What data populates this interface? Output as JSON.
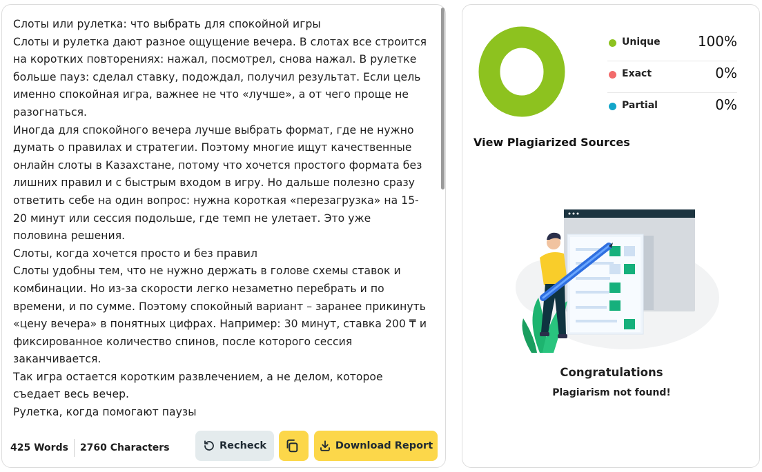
{
  "article": {
    "paragraphs": [
      "Слоты или рулетка: что выбрать для спокойной игры",
      "Слоты и рулетка дают разное ощущение вечера. В слотах все строится на коротких повторениях: нажал, посмотрел, снова нажал. В рулетке больше пауз: сделал ставку, подождал, получил результат. Если цель именно спокойная игра, важнее не что «лучше», а от чего проще не разогнаться.",
      "Иногда для спокойного вечера лучше выбрать формат, где не нужно думать о правилах и стратегии. Поэтому многие ищут качественные онлайн слоты в Казахстане, потому что хочется простого формата без лишних правил и с быстрым входом в игру. Но дальше полезно сразу ответить себе на один вопрос: нужна короткая «перезагрузка» на 15-20 минут или сессия подольше, где темп не улетает. Это уже половина решения.",
      "Слоты, когда хочется просто и без правил",
      "Слоты удобны тем, что не нужно держать в голове схемы ставок и комбинации. Но из-за скорости легко незаметно перебрать и по времени, и по сумме. Поэтому спокойный вариант – заранее прикинуть «цену вечера» в понятных цифрах. Например: 30 минут, ставка 200 ₸ и фиксированное количество спинов, после которого сессия заканчивается.",
      "Так игра остается коротким развлечением, а не делом, которое съедает весь вечер.",
      "Рулетка, когда помогают паузы"
    ]
  },
  "footer": {
    "words": "425 Words",
    "characters": "2760 Characters",
    "recheck_label": "Recheck",
    "download_label": "Download Report"
  },
  "results": {
    "legend": [
      {
        "label": "Unique",
        "value": "100%",
        "percent": 100,
        "color": "#8dc21f"
      },
      {
        "label": "Exact",
        "value": "0%",
        "percent": 0,
        "color": "#f26b6b"
      },
      {
        "label": "Partial",
        "value": "0%",
        "percent": 0,
        "color": "#13a5c9"
      }
    ],
    "view_sources": "View Plagiarized Sources",
    "congrats": "Congratulations",
    "not_found": "Plagiarism not found!"
  },
  "icons": [
    "recheck-icon",
    "copy-icon",
    "download-icon"
  ],
  "colors": {
    "accent_yellow": "#fcd74a",
    "recheck_bg": "#e4ebed"
  }
}
